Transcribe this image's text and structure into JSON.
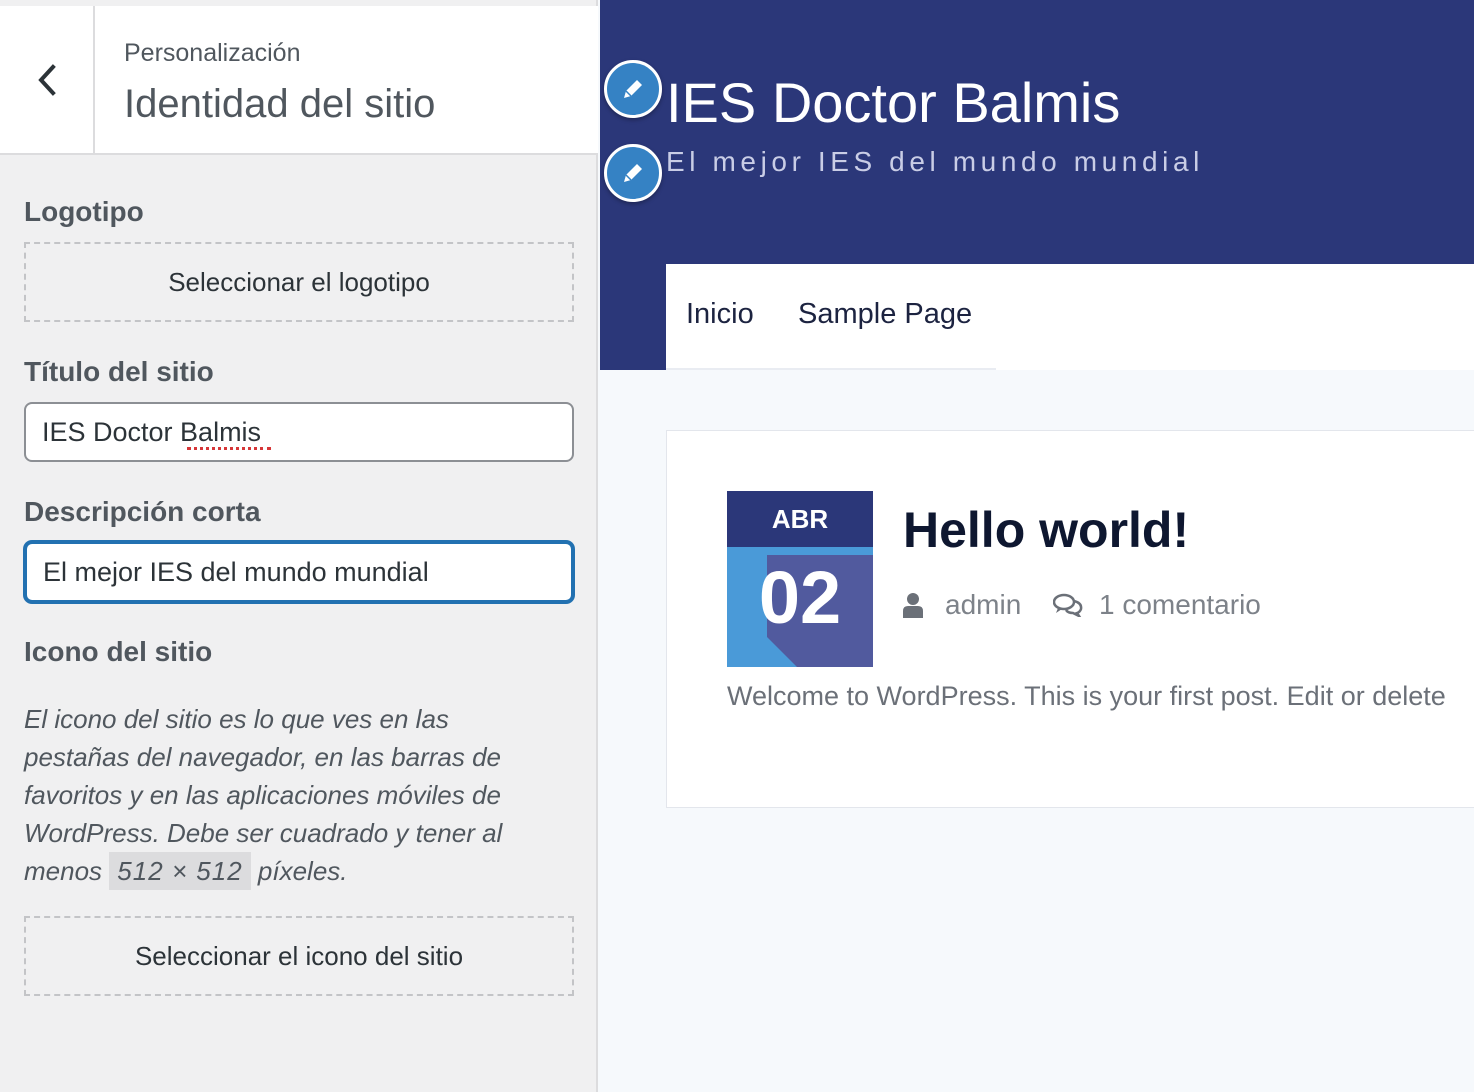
{
  "sidebar": {
    "back_icon": "chevron-left-icon",
    "breadcrumb": "Personalización",
    "title": "Identidad del sitio",
    "logo": {
      "label": "Logotipo",
      "button": "Seleccionar el logotipo"
    },
    "site_title": {
      "label": "Título del sitio",
      "value": "IES Doctor Balmis"
    },
    "tagline": {
      "label": "Descripción corta",
      "value": "El mejor IES del mundo mundial"
    },
    "site_icon": {
      "label": "Icono del sitio",
      "description_before": "El icono del sitio es lo que ves en las pestañas del navegador, en las barras de favoritos y en las aplicaciones móviles de WordPress. Debe ser cuadrado y tener al menos",
      "size_code": "512 × 512",
      "description_after": "píxeles.",
      "button": "Seleccionar el icono del sitio"
    }
  },
  "preview": {
    "site_title": "IES Doctor Balmis",
    "site_description": "El mejor IES del mundo mundial",
    "edit_icon": "pencil-icon",
    "nav": [
      "Inicio",
      "Sample Page"
    ],
    "post": {
      "month": "ABR",
      "day": "02",
      "title": "Hello world!",
      "author": "admin",
      "author_icon": "user-icon",
      "comments": "1 comentario",
      "comments_icon": "comments-icon",
      "excerpt": "Welcome to WordPress. This is your first post. Edit or delete"
    }
  },
  "colors": {
    "header_bg": "#2b3779",
    "date_day_bg": "#4a9ad8",
    "date_shadow": "#515a9e",
    "focus_border": "#2271b1",
    "edit_shortcut": "#3582c4"
  }
}
